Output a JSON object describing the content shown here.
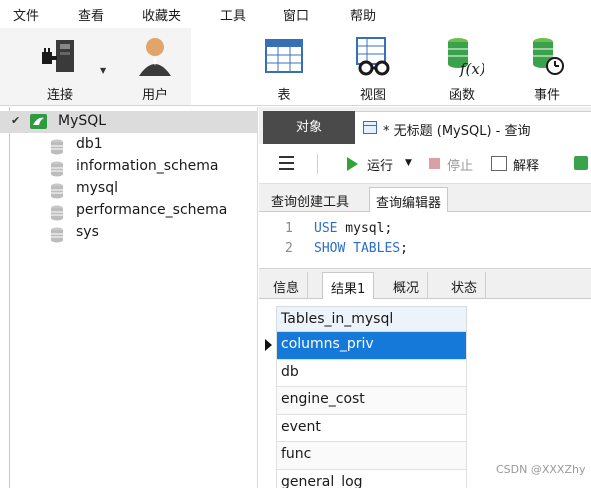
{
  "menubar": {
    "items": [
      "文件",
      "查看",
      "收藏夹",
      "工具",
      "窗口",
      "帮助"
    ]
  },
  "toolbar": {
    "tools": [
      {
        "label": "连接",
        "icon": "plug-connection-icon"
      },
      {
        "label": "用户",
        "icon": "user-icon"
      },
      {
        "label": "表",
        "icon": "table-icon"
      },
      {
        "label": "视图",
        "icon": "view-glasses-icon"
      },
      {
        "label": "函数",
        "icon": "function-fx-icon"
      },
      {
        "label": "事件",
        "icon": "event-clock-icon"
      }
    ]
  },
  "navigator": {
    "connection": "MySQL",
    "databases": [
      "db1",
      "information_schema",
      "mysql",
      "performance_schema",
      "sys"
    ]
  },
  "tabs": {
    "objects": "对象",
    "query_tab": "* 无标题 (MySQL) - 查询"
  },
  "query_toolbar": {
    "run": "运行",
    "stop": "停止",
    "explain": "解释"
  },
  "editor_tabs": [
    "查询创建工具",
    "查询编辑器"
  ],
  "editor": {
    "lines": [
      {
        "no": "1",
        "keyword": "USE",
        "rest": " mysql;"
      },
      {
        "no": "2",
        "keyword": "SHOW TABLES",
        "rest": ";"
      }
    ]
  },
  "result_tabs": [
    "信息",
    "结果1",
    "概况",
    "状态"
  ],
  "result_grid": {
    "column": "Tables_in_mysql",
    "rows": [
      "columns_priv",
      "db",
      "engine_cost",
      "event",
      "func",
      "general_log"
    ],
    "selected_index": 0
  },
  "watermark": "CSDN @XXXZhy",
  "colors": {
    "selection": "#1479d9",
    "keyword": "#2d6ec7",
    "run_green": "#33a13a",
    "object_tab": "#4a4a4a"
  }
}
